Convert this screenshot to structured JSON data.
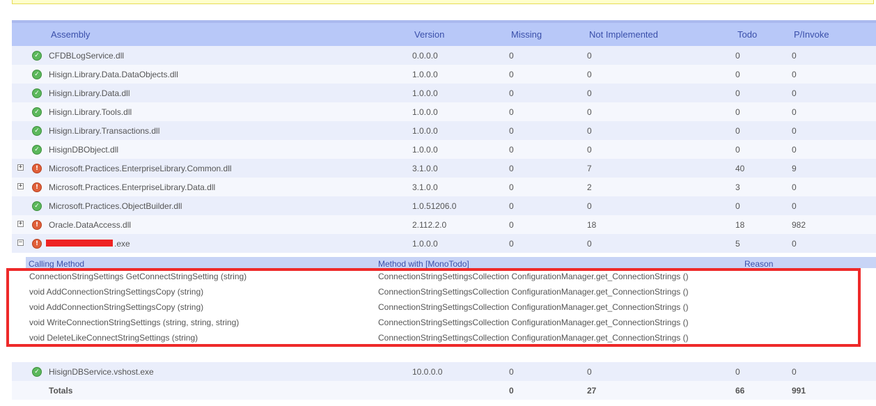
{
  "header": {
    "assembly": "Assembly",
    "version": "Version",
    "missing": "Missing",
    "not_implemented": "Not Implemented",
    "todo": "Todo",
    "pinvoke": "P/Invoke"
  },
  "rows": [
    {
      "name": "CFDBLogService.dll",
      "version": "0.0.0.0",
      "missing": "0",
      "ni": "0",
      "todo": "0",
      "pinvoke": "0",
      "status": "ok",
      "expand": ""
    },
    {
      "name": "Hisign.Library.Data.DataObjects.dll",
      "version": "1.0.0.0",
      "missing": "0",
      "ni": "0",
      "todo": "0",
      "pinvoke": "0",
      "status": "ok",
      "expand": ""
    },
    {
      "name": "Hisign.Library.Data.dll",
      "version": "1.0.0.0",
      "missing": "0",
      "ni": "0",
      "todo": "0",
      "pinvoke": "0",
      "status": "ok",
      "expand": ""
    },
    {
      "name": "Hisign.Library.Tools.dll",
      "version": "1.0.0.0",
      "missing": "0",
      "ni": "0",
      "todo": "0",
      "pinvoke": "0",
      "status": "ok",
      "expand": ""
    },
    {
      "name": "Hisign.Library.Transactions.dll",
      "version": "1.0.0.0",
      "missing": "0",
      "ni": "0",
      "todo": "0",
      "pinvoke": "0",
      "status": "ok",
      "expand": ""
    },
    {
      "name": "HisignDBObject.dll",
      "version": "1.0.0.0",
      "missing": "0",
      "ni": "0",
      "todo": "0",
      "pinvoke": "0",
      "status": "ok",
      "expand": ""
    },
    {
      "name": "Microsoft.Practices.EnterpriseLibrary.Common.dll",
      "version": "3.1.0.0",
      "missing": "0",
      "ni": "7",
      "todo": "40",
      "pinvoke": "9",
      "status": "err",
      "expand": "+"
    },
    {
      "name": "Microsoft.Practices.EnterpriseLibrary.Data.dll",
      "version": "3.1.0.0",
      "missing": "0",
      "ni": "2",
      "todo": "3",
      "pinvoke": "0",
      "status": "err",
      "expand": "+"
    },
    {
      "name": "Microsoft.Practices.ObjectBuilder.dll",
      "version": "1.0.51206.0",
      "missing": "0",
      "ni": "0",
      "todo": "0",
      "pinvoke": "0",
      "status": "ok",
      "expand": ""
    },
    {
      "name": "Oracle.DataAccess.dll",
      "version": "2.112.2.0",
      "missing": "0",
      "ni": "18",
      "todo": "18",
      "pinvoke": "982",
      "status": "err",
      "expand": "+"
    },
    {
      "name": ".exe",
      "version": "1.0.0.0",
      "missing": "0",
      "ni": "0",
      "todo": "5",
      "pinvoke": "0",
      "status": "err",
      "expand": "−"
    }
  ],
  "detail": {
    "calling_method": "Calling Method",
    "method_with": "Method with [MonoTodo]",
    "reason": "Reason",
    "items": [
      {
        "caller": "ConnectionStringSettings GetConnectStringSetting (string)",
        "method": "ConnectionStringSettingsCollection ConfigurationManager.get_ConnectionStrings ()"
      },
      {
        "caller": "void AddConnectionStringSettingsCopy (string)",
        "method": "ConnectionStringSettingsCollection ConfigurationManager.get_ConnectionStrings ()"
      },
      {
        "caller": "void AddConnectionStringSettingsCopy (string)",
        "method": "ConnectionStringSettingsCollection ConfigurationManager.get_ConnectionStrings ()"
      },
      {
        "caller": "void WriteConnectionStringSettings (string, string, string)",
        "method": "ConnectionStringSettingsCollection ConfigurationManager.get_ConnectionStrings ()"
      },
      {
        "caller": "void DeleteLikeConnectStringSettings (string)",
        "method": "ConnectionStringSettingsCollection ConfigurationManager.get_ConnectionStrings ()"
      }
    ]
  },
  "last_row": {
    "name": "HisignDBService.vshost.exe",
    "version": "10.0.0.0",
    "missing": "0",
    "ni": "0",
    "todo": "0",
    "pinvoke": "0",
    "status": "ok"
  },
  "totals": {
    "label": "Totals",
    "missing": "0",
    "ni": "27",
    "todo": "66",
    "pinvoke": "991"
  },
  "colors": {
    "header_bg": "#b8c8f8",
    "row_odd": "#eaeefb",
    "row_even": "#f5f7fd",
    "highlight": "#ee2a2a",
    "ok": "#5cb85c",
    "error": "#e0603a"
  }
}
